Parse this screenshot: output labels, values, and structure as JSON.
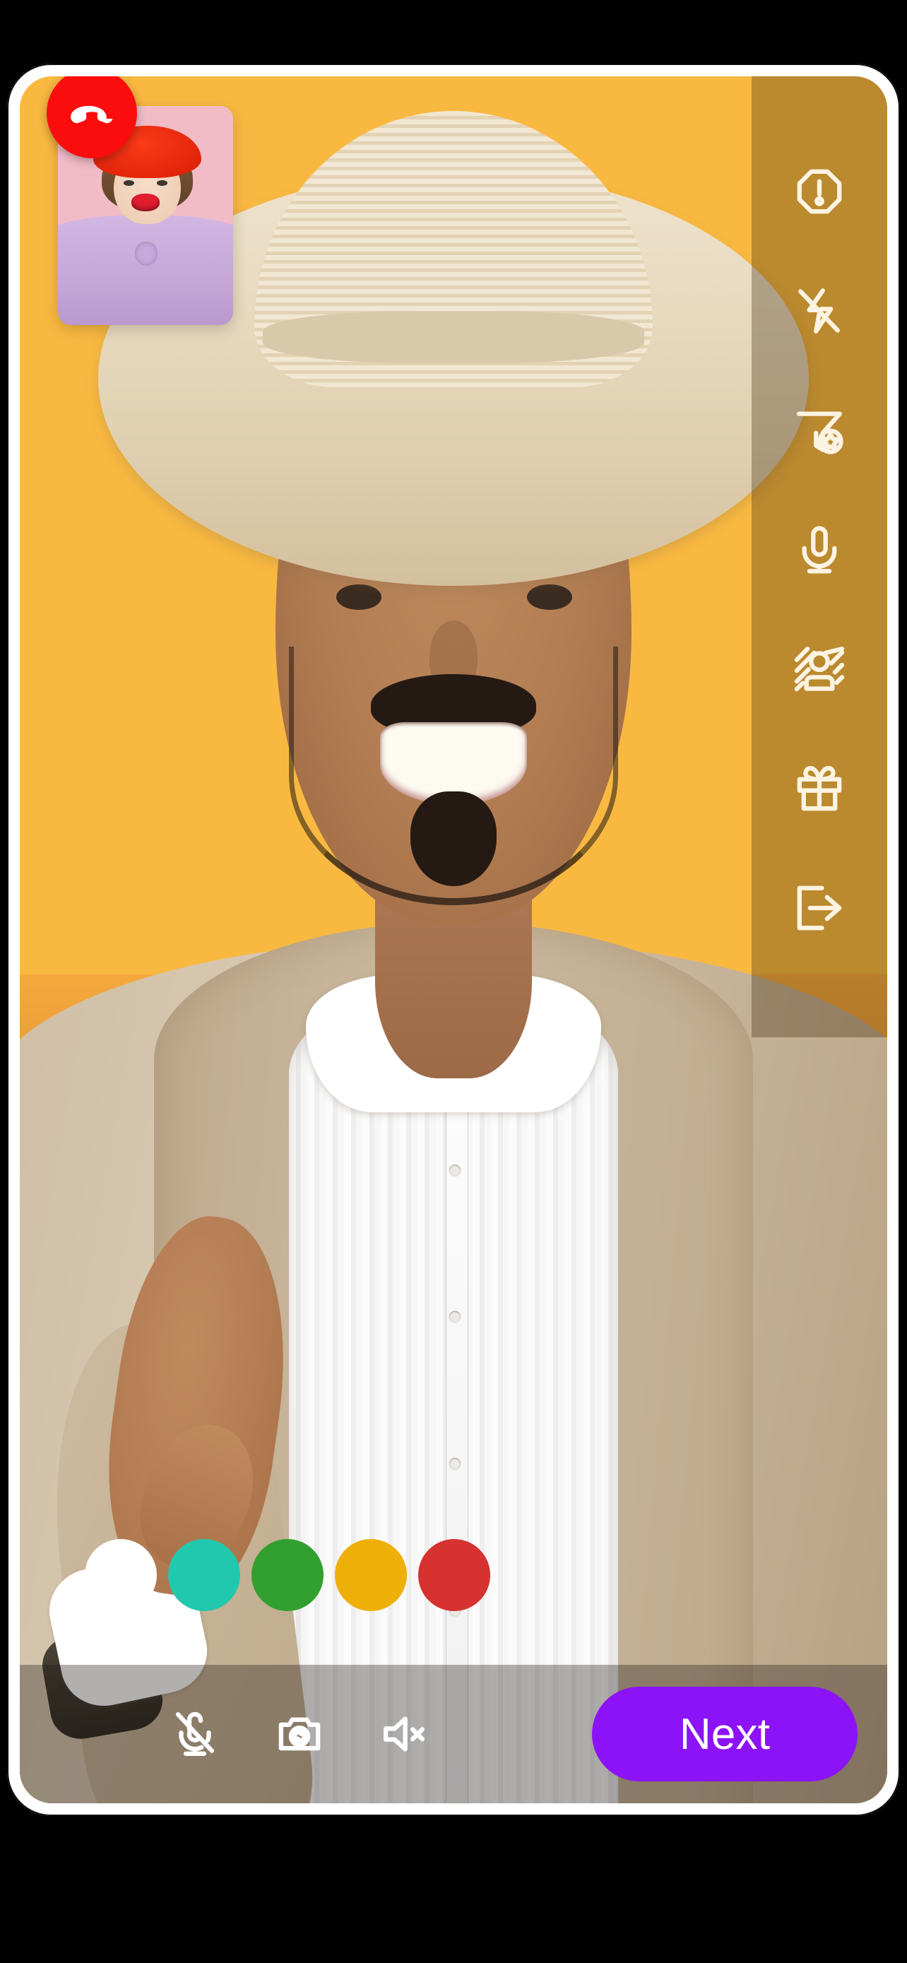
{
  "app": {
    "screen_title": "Video Call",
    "frame_color": "#ffffff",
    "background_color": "#000000"
  },
  "remote_video": {
    "name": "remote-participant-video",
    "description": "Smiling man in straw hat and beige blazer pointing at camera",
    "background_color": "#f9b941",
    "surface_color": "#c8763a"
  },
  "pip_video": {
    "name": "local-participant-video",
    "description": "Woman in red beret and lilac blouse on pink background",
    "background_color": "#f2bcc6",
    "hat_color": "#e32208",
    "blouse_color": "#c4a5d6"
  },
  "sidebar": {
    "overlay_color": "rgba(60,40,10,0.33)",
    "icon_color": "#fdf3e2",
    "items": [
      {
        "icon": "report-octagon-icon",
        "label": "Report"
      },
      {
        "icon": "flash-off-icon",
        "label": "Flash Off"
      },
      {
        "icon": "filter-star-icon",
        "label": "Filters"
      },
      {
        "icon": "microphone-icon",
        "label": "Microphone"
      },
      {
        "icon": "blur-person-icon",
        "label": "Blur Background"
      },
      {
        "icon": "gift-icon",
        "label": "Send Gift"
      },
      {
        "icon": "exit-icon",
        "label": "Leave"
      }
    ]
  },
  "filters": {
    "label": "Color Filters",
    "swatches": [
      {
        "name": "filter-swatch-none",
        "label": "None",
        "color": "#ffffff"
      },
      {
        "name": "filter-swatch-teal",
        "label": "Teal",
        "color": "#22c8ae"
      },
      {
        "name": "filter-swatch-green",
        "label": "Green",
        "color": "#31a02e"
      },
      {
        "name": "filter-swatch-amber",
        "label": "Amber",
        "color": "#eeb008"
      },
      {
        "name": "filter-swatch-red",
        "label": "Red",
        "color": "#d63230"
      }
    ]
  },
  "bottom_bar": {
    "overlay_color": "rgba(30,24,20,0.34)",
    "hangup": {
      "label": "End Call",
      "color": "#fb0d0d",
      "icon": "phone-hangup-icon"
    },
    "controls": [
      {
        "icon": "microphone-muted-icon",
        "label": "Unmute Microphone",
        "state": "muted"
      },
      {
        "icon": "camera-flip-icon",
        "label": "Switch Camera",
        "state": "active"
      },
      {
        "icon": "speaker-muted-icon",
        "label": "Unmute Speaker",
        "state": "muted"
      }
    ],
    "next": {
      "label": "Next",
      "color": "#8c12f7"
    }
  }
}
